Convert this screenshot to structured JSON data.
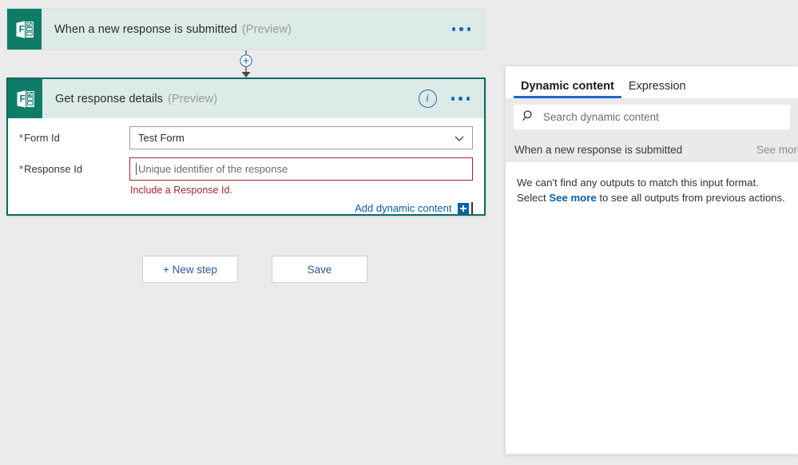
{
  "canvas": {
    "trigger": {
      "icon": "microsoft-forms-icon",
      "title": "When a new response is submitted",
      "preview_label": "(Preview)",
      "menu_icon": "ellipsis-icon"
    },
    "connector": {
      "add_icon": "plus-circle-icon",
      "arrow_icon": "arrow-down-icon"
    },
    "action": {
      "icon": "microsoft-forms-icon",
      "title": "Get response details",
      "preview_label": "(Preview)",
      "info_icon": "info-icon",
      "info_glyph": "i",
      "menu_icon": "ellipsis-icon",
      "fields": [
        {
          "required_marker": "*",
          "label": "Form Id",
          "control": "dropdown",
          "value": "Test Form",
          "chevron_icon": "chevron-down-icon"
        },
        {
          "required_marker": "*",
          "label": "Response Id",
          "control": "textbox",
          "value": "",
          "placeholder": "Unique identifier of the response",
          "error": "Include a Response Id."
        }
      ],
      "add_dynamic_content": {
        "label": "Add dynamic content",
        "icon": "plus-square-icon"
      }
    },
    "buttons": [
      {
        "name": "new-step",
        "label": "+ New step"
      },
      {
        "name": "save",
        "label": "Save"
      }
    ]
  },
  "panel": {
    "tabs": [
      {
        "label": "Dynamic content",
        "active": true
      },
      {
        "label": "Expression",
        "active": false
      }
    ],
    "search": {
      "icon": "search-icon",
      "placeholder": "Search dynamic content",
      "value": ""
    },
    "group": {
      "title": "When a new response is submitted",
      "see_more_label": "See more"
    },
    "empty_state": {
      "line1": "We can't find any outputs to match this input format.",
      "line2_prefix": "Select ",
      "line2_link": "See more",
      "line2_suffix": " to see all outputs from previous actions."
    }
  },
  "colors": {
    "forms_teal": "#0f7c68",
    "card_header_teal": "#dcebe8",
    "selected_border": "#0b6a62",
    "error_red": "#a4262c",
    "link_blue": "#0a5fa8",
    "tab_underline": "#2266cc",
    "canvas_bg": "#ebebeb"
  }
}
